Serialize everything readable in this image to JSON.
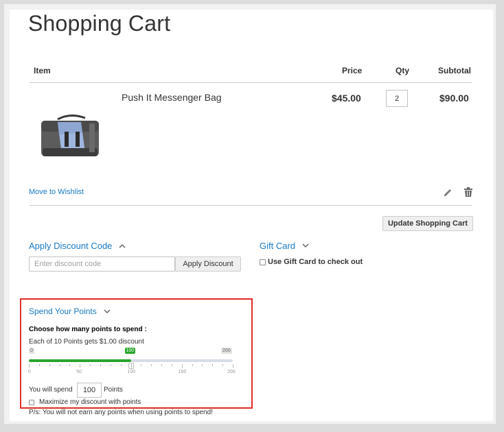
{
  "page": {
    "title": "Shopping Cart"
  },
  "cart_table": {
    "headers": {
      "item": "Item",
      "price": "Price",
      "qty": "Qty",
      "subtotal": "Subtotal"
    },
    "rows": [
      {
        "name": "Push It Messenger Bag",
        "price": "$45.00",
        "qty": "2",
        "subtotal": "$90.00"
      }
    ],
    "move_to_wishlist": "Move to Wishlist",
    "update_button": "Update Shopping Cart"
  },
  "discount": {
    "title": "Apply Discount Code",
    "placeholder": "Enter discount code",
    "button": "Apply Discount"
  },
  "gift_card": {
    "title": "Gift Card",
    "checkbox_label": "Use Gift Card to check out"
  },
  "points": {
    "title": "Spend Your Points",
    "subtitle": "Choose how many points to spend :",
    "rate_text": "Each of 10 Points gets $1.00 discount",
    "slider": {
      "min_label": "0",
      "max_label": "200",
      "current_label": "100",
      "value": 100,
      "min": 0,
      "max": 200,
      "tick_labels": [
        "0",
        "50",
        "100",
        "150",
        "200"
      ]
    },
    "spend_prefix": "You will spend",
    "spend_value": "100",
    "spend_suffix": "Points",
    "maximize_label": "Maximize my discount with points",
    "note": "P/s: You will not earn any points when using points to spend!"
  },
  "colors": {
    "accent": "#1979c3",
    "slider_fill": "#2aa52a",
    "highlight_border": "#e02b27"
  }
}
